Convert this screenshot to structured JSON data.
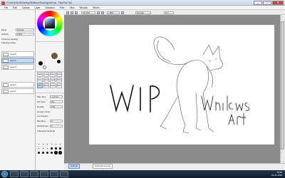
{
  "window": {
    "title": "C:\\Users\\Wolf\\Desktop\\Whitlews\\Drawing\\wolf.sai - PaintTool SAI",
    "min": "_",
    "max": "□",
    "close": "✕"
  },
  "menu": [
    "File",
    "Edit",
    "Canvas",
    "Layer",
    "Selection",
    "Filter",
    "View",
    "Window",
    "Others"
  ],
  "toolbar": {
    "zoom": "33.33%",
    "angle": "+000°",
    "normal": "Normal",
    "stabilizer": "S-7"
  },
  "layers_panel": {
    "mode_label": "Mode",
    "mode_value": "Normal",
    "opacity_label": "Opacity",
    "opacity_value": "100%",
    "protect_label": "Preserve Opacity",
    "clipping_label": "Clipping Group",
    "items": [
      {
        "name": "Layer5"
      },
      {
        "name": "Layer4"
      },
      {
        "name": "Layer3"
      },
      {
        "name": "Layer2"
      },
      {
        "name": "Layer1"
      }
    ]
  },
  "colors": {
    "primary": "#000000",
    "accent": "#1a5fd0",
    "canvas_bg": "#ffffff",
    "workspace": "#8b8b8b"
  },
  "tools": [
    "Select",
    "Lasso",
    "Wand",
    "Move",
    "Zoom",
    "Rotate",
    "Hand",
    "Picker",
    "Pen",
    "Brush",
    "Eraser",
    "Marker"
  ],
  "tool_settings": {
    "rows": [
      {
        "label": "Max Size",
        "value": "x1.0  5.0"
      },
      {
        "label": "Min Size",
        "value": "0%"
      },
      {
        "label": "Density",
        "value": "100"
      },
      {
        "label": "(simple circle)",
        "value": ""
      },
      {
        "label": "(no texture)",
        "value": ""
      },
      {
        "label": "Blending",
        "value": "0"
      },
      {
        "label": "Persistence",
        "value": "0"
      },
      {
        "label": "Advanced Settings",
        "value": ""
      }
    ]
  },
  "brush_sizes": [
    1,
    1.5,
    2,
    2.3,
    2.6,
    3,
    3.5,
    4,
    5,
    6,
    7,
    8,
    9,
    10,
    12,
    14,
    16,
    20
  ],
  "canvas": {
    "wip_text": "WIP",
    "signature_line1": "Whitlews",
    "signature_line2": "Art"
  },
  "status": {
    "doc_tabs": [
      "wolf.sai",
      "wolf with text.sai"
    ],
    "zoom": "33%"
  },
  "taskbar": {
    "time": "19:00",
    "date": "01.01.2015"
  }
}
